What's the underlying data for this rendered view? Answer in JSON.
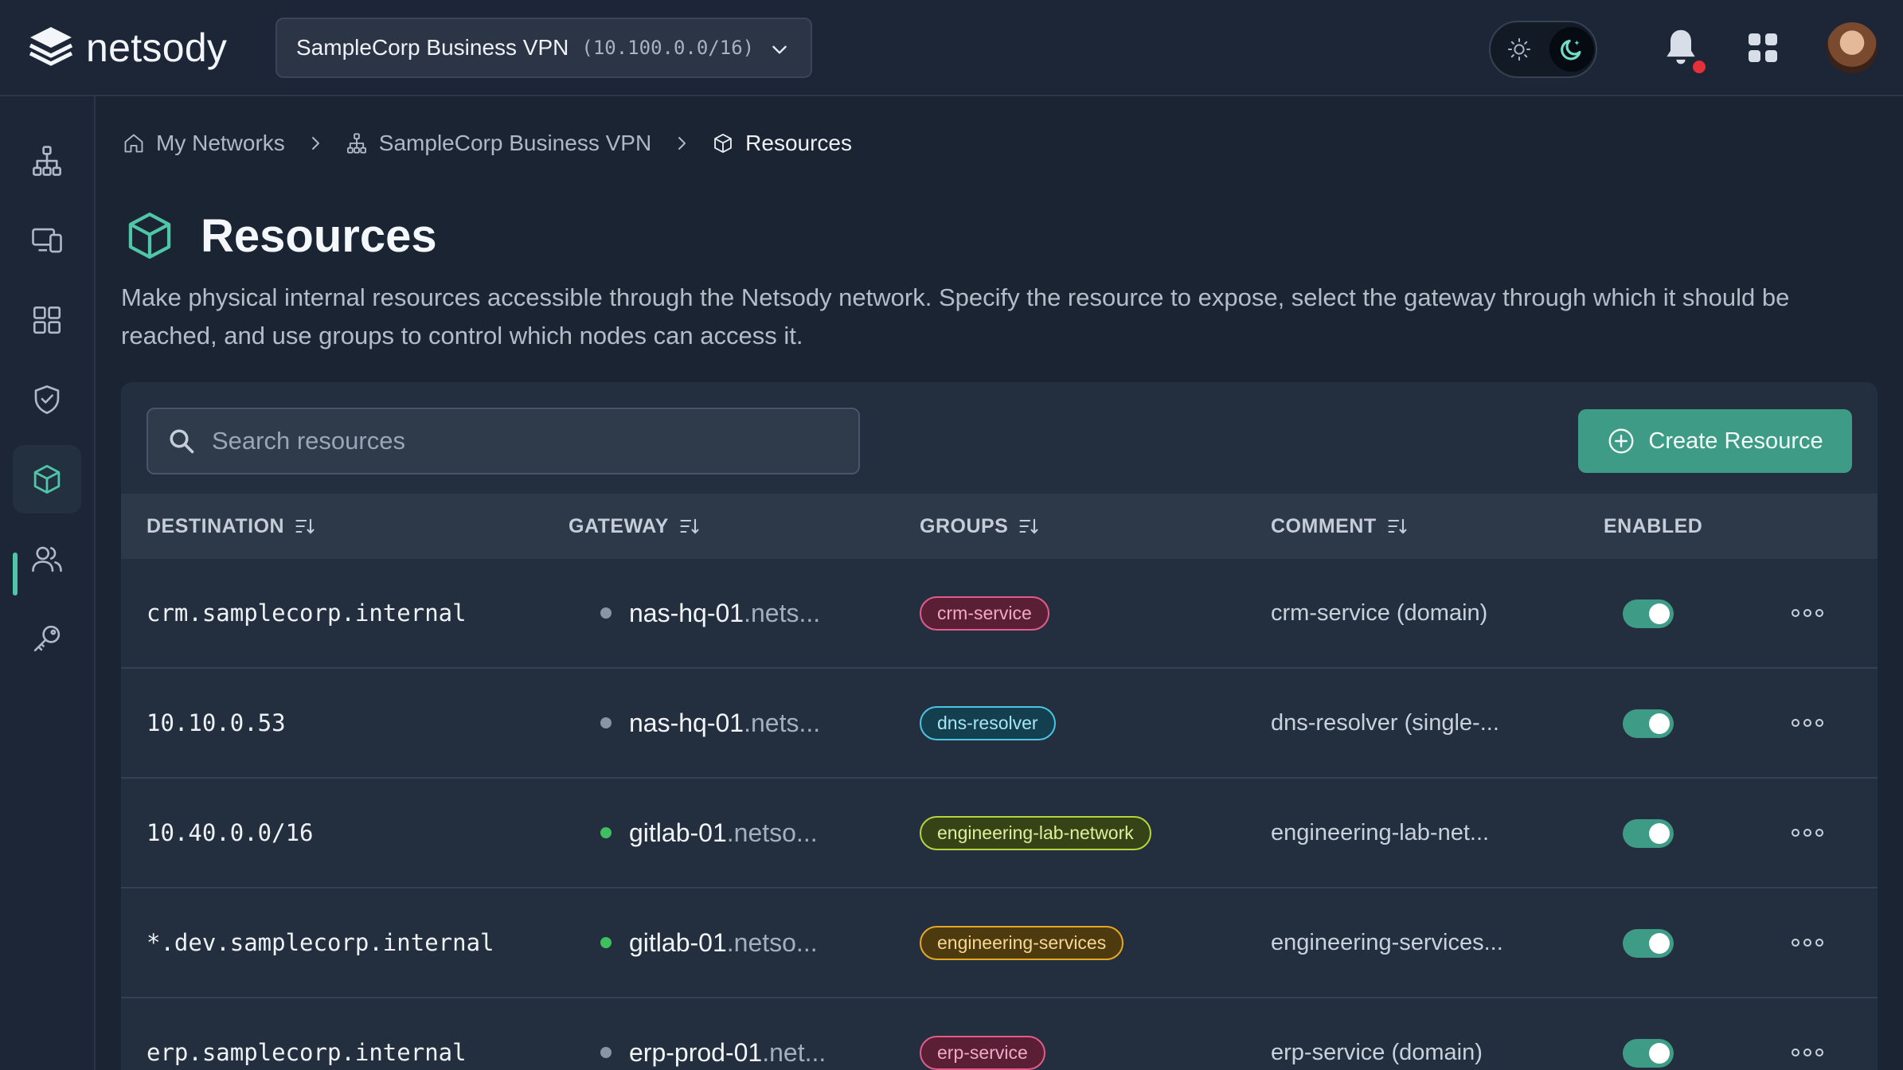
{
  "app": {
    "brand": "netsody"
  },
  "header": {
    "network_name": "SampleCorp Business VPN",
    "network_cidr": "(10.100.0.0/16)",
    "icons": [
      "logo-icon",
      "chevron-down-icon",
      "sun-icon",
      "moon-icon",
      "bell-icon",
      "apps-grid-icon",
      "avatar"
    ],
    "notification_dot_color": "#e5303b"
  },
  "sidebar": {
    "items": [
      {
        "name": "network-topology-icon"
      },
      {
        "name": "devices-icon"
      },
      {
        "name": "dashboard-grid-icon"
      },
      {
        "name": "shield-check-icon"
      },
      {
        "name": "resources-cube-icon",
        "active": true
      },
      {
        "name": "users-icon"
      },
      {
        "name": "key-icon"
      }
    ],
    "accent_color": "#4fc6a8"
  },
  "breadcrumb": {
    "items": [
      {
        "label": "My Networks",
        "icon": "home-icon"
      },
      {
        "label": "SampleCorp Business VPN",
        "icon": "network-icon"
      },
      {
        "label": "Resources",
        "icon": "cube-icon"
      }
    ]
  },
  "page": {
    "title": "Resources",
    "description": "Make physical internal resources accessible through the Netsody network. Specify the resource to expose, select the gateway through which it should be reached, and use groups to control which nodes can access it."
  },
  "toolbar": {
    "search_placeholder": "Search resources",
    "create_label": "Create Resource",
    "create_color": "#3e9c86"
  },
  "table": {
    "columns": [
      "DESTINATION",
      "GATEWAY",
      "GROUPS",
      "COMMENT",
      "ENABLED"
    ],
    "rows": [
      {
        "destination": "crm.samplecorp.internal",
        "gateway_host": "nas-hq-01",
        "gateway_domain": ".nets...",
        "gateway_status": "offline",
        "group": "crm-service",
        "group_style": "pink",
        "comment": "crm-service (domain)",
        "enabled": true
      },
      {
        "destination": "10.10.0.53",
        "gateway_host": "nas-hq-01",
        "gateway_domain": ".nets...",
        "gateway_status": "offline",
        "group": "dns-resolver",
        "group_style": "cyan",
        "comment": "dns-resolver (single-...",
        "enabled": true
      },
      {
        "destination": "10.40.0.0/16",
        "gateway_host": "gitlab-01",
        "gateway_domain": ".netso...",
        "gateway_status": "online",
        "group": "engineering-lab-network",
        "group_style": "lime",
        "comment": "engineering-lab-net...",
        "enabled": true
      },
      {
        "destination": "*.dev.samplecorp.internal",
        "gateway_host": "gitlab-01",
        "gateway_domain": ".netso...",
        "gateway_status": "online",
        "group": "engineering-services",
        "group_style": "amber",
        "comment": "engineering-services...",
        "enabled": true
      },
      {
        "destination": "erp.samplecorp.internal",
        "gateway_host": "erp-prod-01",
        "gateway_domain": ".net...",
        "gateway_status": "offline",
        "group": "erp-service",
        "group_style": "pink",
        "comment": "erp-service (domain)",
        "enabled": true
      }
    ],
    "status_colors": {
      "online": "#3fbf5f",
      "offline": "#8a94a3"
    },
    "chip_styles": {
      "pink": {
        "bg": "#5a1f35",
        "border": "#e05c8a",
        "text": "#f3a9c4"
      },
      "cyan": {
        "bg": "#143f4e",
        "border": "#4cc3e0",
        "text": "#a6e6f5"
      },
      "lime": {
        "bg": "#364317",
        "border": "#b4d63c",
        "text": "#dff09a"
      },
      "amber": {
        "bg": "#4e3a0f",
        "border": "#e6a823",
        "text": "#f7d890"
      }
    }
  }
}
